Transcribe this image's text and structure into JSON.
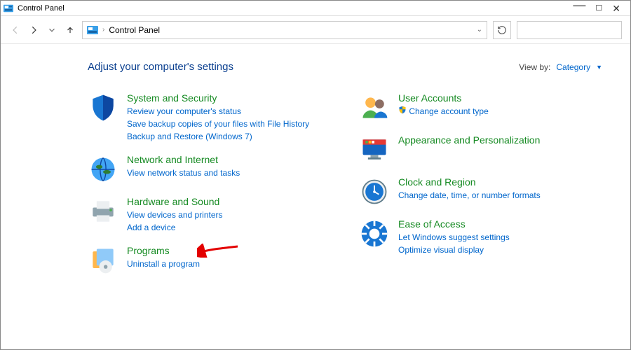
{
  "window": {
    "title": "Control Panel"
  },
  "address": {
    "crumb": "Control Panel"
  },
  "header": {
    "title": "Adjust your computer's settings",
    "viewby_label": "View by:",
    "viewby_value": "Category"
  },
  "left_col": [
    {
      "title": "System and Security",
      "links": [
        "Review your computer's status",
        "Save backup copies of your files with File History",
        "Backup and Restore (Windows 7)"
      ]
    },
    {
      "title": "Network and Internet",
      "links": [
        "View network status and tasks"
      ]
    },
    {
      "title": "Hardware and Sound",
      "links": [
        "View devices and printers",
        "Add a device"
      ]
    },
    {
      "title": "Programs",
      "links": [
        "Uninstall a program"
      ]
    }
  ],
  "right_col": [
    {
      "title": "User Accounts",
      "links": [
        "Change account type"
      ],
      "shield": true
    },
    {
      "title": "Appearance and Personalization",
      "links": []
    },
    {
      "title": "Clock and Region",
      "links": [
        "Change date, time, or number formats"
      ]
    },
    {
      "title": "Ease of Access",
      "links": [
        "Let Windows suggest settings",
        "Optimize visual display"
      ]
    }
  ]
}
